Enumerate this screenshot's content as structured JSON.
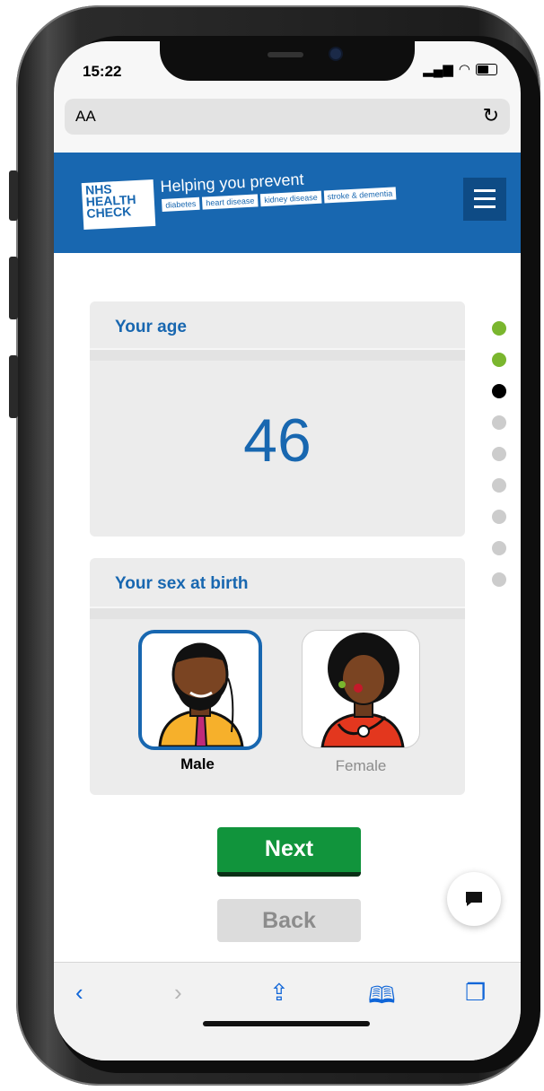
{
  "status_bar": {
    "time": "15:22"
  },
  "browser": {
    "text_size_label": "AA",
    "reload_icon": "reload-icon"
  },
  "header": {
    "logo_line1": "NHS",
    "logo_line2": "HEALTH",
    "logo_line3": "CHECK",
    "tagline": "Helping you prevent",
    "tags": [
      "diabetes",
      "heart disease",
      "kidney disease",
      "stroke & dementia"
    ],
    "menu_icon": "hamburger-menu-icon",
    "brand_color": "#1867b0"
  },
  "age_card": {
    "title": "Your age",
    "value": "46"
  },
  "progress": {
    "steps": [
      "complete",
      "complete",
      "current",
      "pending",
      "pending",
      "pending",
      "pending",
      "pending",
      "pending"
    ],
    "colors": {
      "complete": "#7ab62e",
      "current": "#000000",
      "pending": "#cccccc"
    }
  },
  "sex_card": {
    "title": "Your sex at birth",
    "options": [
      {
        "label": "Male",
        "selected": true
      },
      {
        "label": "Female",
        "selected": false
      }
    ]
  },
  "buttons": {
    "next": "Next",
    "back": "Back",
    "next_color": "#11943c"
  },
  "chat": {
    "icon": "chat-bubble-icon"
  },
  "toolbar": {
    "icons": [
      "back-chevron-icon",
      "forward-chevron-icon",
      "share-icon",
      "bookmarks-icon",
      "tabs-icon"
    ]
  }
}
